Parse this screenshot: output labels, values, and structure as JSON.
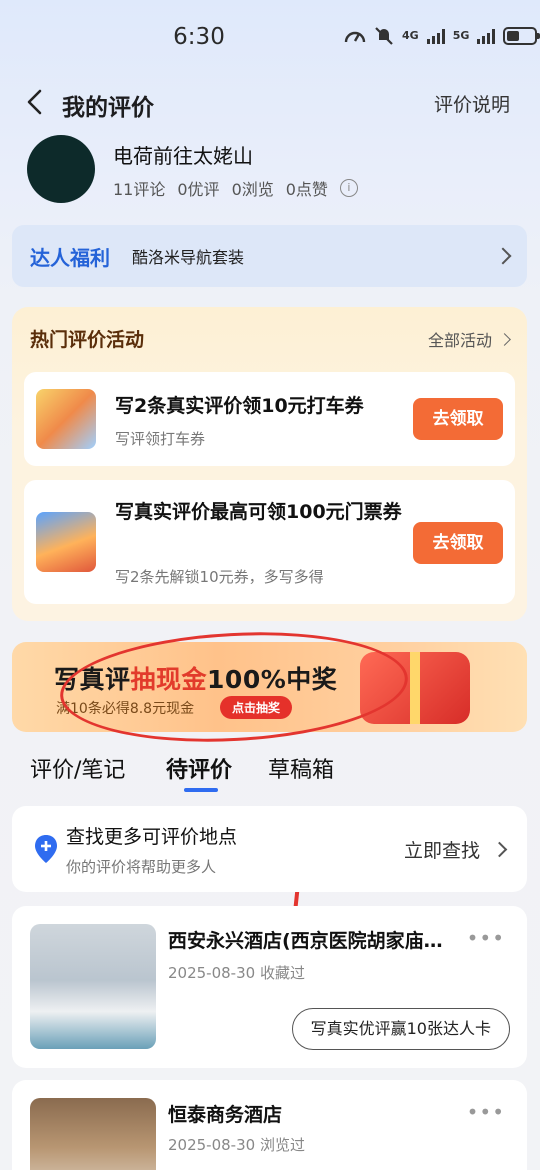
{
  "status": {
    "time": "6:30",
    "net1": "4G",
    "net2": "5G"
  },
  "header": {
    "title": "我的评价",
    "right_link": "评价说明"
  },
  "profile": {
    "username": "电荷前往太姥山",
    "stats": [
      "11评论",
      "0优评",
      "0浏览",
      "0点赞"
    ],
    "info_icon": "i"
  },
  "welfare": {
    "tag": "达人福利",
    "text": "酷洛米导航套装"
  },
  "hot": {
    "title": "热门评价活动",
    "all_link": "全部活动",
    "items": [
      {
        "title": "写2条真实评价领10元打车券",
        "subtitle": "写评领打车券",
        "button": "去领取"
      },
      {
        "title": "写真实评价最高可领100元门票券",
        "subtitle": "写2条先解锁10元券，多写多得",
        "button": "去领取"
      }
    ]
  },
  "banner": {
    "prefix": "写真评",
    "highlight": "抽现金",
    "suffix": "100%中奖",
    "sub": "满10条必得8.8元现金",
    "button": "点击抽奖"
  },
  "tabs": [
    {
      "label": "评价/笔记",
      "active": false
    },
    {
      "label": "待评价",
      "active": true
    },
    {
      "label": "草稿箱",
      "active": false
    }
  ],
  "find_more": {
    "title": "查找更多可评价地点",
    "subtitle": "你的评价将帮助更多人",
    "action": "立即查找"
  },
  "places": [
    {
      "name": "西安永兴酒店(西京医院胡家庙…",
      "meta": "2025-08-30 收藏过",
      "action": "写真实优评赢10张达人卡",
      "more": "•••"
    },
    {
      "name": "恒泰商务酒店",
      "meta": "2025-08-30 浏览过",
      "more": "•••"
    }
  ],
  "colors": {
    "accent_blue": "#2f6cf0",
    "accent_orange": "#f36b36",
    "annotation_red": "#e3352f"
  },
  "icons": [
    "back-chevron-icon",
    "info-icon",
    "chevron-right-icon",
    "location-pin-icon",
    "more-dots-icon",
    "battery-icon",
    "signal-icon"
  ]
}
